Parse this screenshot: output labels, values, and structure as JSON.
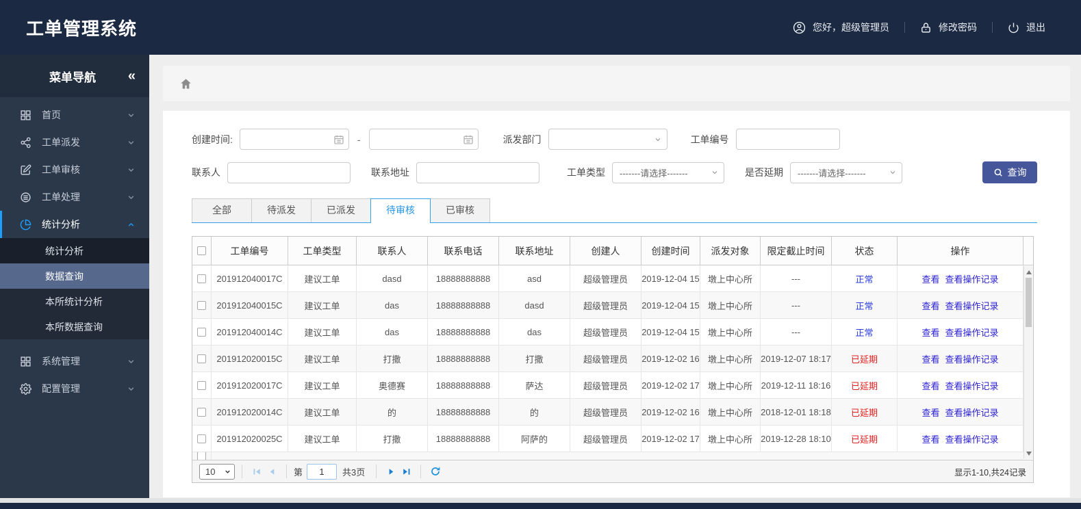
{
  "header": {
    "title": "工单管理系统",
    "greeting": "您好，超级管理员",
    "change_password": "修改密码",
    "logout": "退出"
  },
  "sidebar": {
    "title": "菜单导航",
    "collapse_icon": "«",
    "items": [
      {
        "key": "home",
        "label": "首页",
        "icon": "grid-icon"
      },
      {
        "key": "dispatch",
        "label": "工单派发",
        "icon": "share-icon"
      },
      {
        "key": "review",
        "label": "工单审核",
        "icon": "edit-icon"
      },
      {
        "key": "process",
        "label": "工单处理",
        "icon": "database-icon"
      },
      {
        "key": "stats",
        "label": "统计分析",
        "icon": "pie-chart-icon",
        "expanded": true,
        "children": [
          {
            "key": "stats-analysis",
            "label": "统计分析"
          },
          {
            "key": "data-query",
            "label": "数据查询",
            "selected": true
          },
          {
            "key": "branch-stats",
            "label": "本所统计分析"
          },
          {
            "key": "branch-data-query",
            "label": "本所数据查询"
          }
        ]
      },
      {
        "key": "system",
        "label": "系统管理",
        "icon": "apps-icon",
        "gap": true
      },
      {
        "key": "config",
        "label": "配置管理",
        "icon": "gear-icon"
      }
    ]
  },
  "filters": {
    "create_time_label": "创建时间:",
    "range_separator": "-",
    "dispatch_dept_label": "派发部门",
    "order_no_label": "工单编号",
    "contact_label": "联系人",
    "address_label": "联系地址",
    "order_type_label": "工单类型",
    "order_type_value": "-------请选择-------",
    "delay_label": "是否延期",
    "delay_value": "-------请选择-------",
    "search_button_label": "查询"
  },
  "tabs": [
    {
      "key": "all",
      "label": "全部"
    },
    {
      "key": "pending-dispatch",
      "label": "待派发"
    },
    {
      "key": "dispatched",
      "label": "已派发"
    },
    {
      "key": "pending-review",
      "label": "待审核",
      "active": true
    },
    {
      "key": "reviewed",
      "label": "已审核"
    }
  ],
  "table": {
    "columns": [
      "工单编号",
      "工单类型",
      "联系人",
      "联系电话",
      "联系地址",
      "创建人",
      "创建时间",
      "派发对象",
      "限定截止时间",
      "状态",
      "操作"
    ],
    "action_labels": [
      "查看",
      "查看操作记录"
    ],
    "status_colors": {
      "正常": "#2b3cd9",
      "已延期": "#e02020"
    },
    "rows": [
      {
        "order_no": "201912040017C",
        "order_type": "建议工单",
        "contact": "dasd",
        "phone": "18888888888",
        "address": "asd",
        "creator": "超级管理员",
        "created_at": "2019-12-04 15",
        "dispatch_target": "墩上中心所",
        "deadline": "---",
        "status": "正常"
      },
      {
        "order_no": "201912040015C",
        "order_type": "建议工单",
        "contact": "das",
        "phone": "18888888888",
        "address": "dasd",
        "creator": "超级管理员",
        "created_at": "2019-12-04 15",
        "dispatch_target": "墩上中心所",
        "deadline": "---",
        "status": "正常"
      },
      {
        "order_no": "201912040014C",
        "order_type": "建议工单",
        "contact": "das",
        "phone": "18888888888",
        "address": "das",
        "creator": "超级管理员",
        "created_at": "2019-12-04 15",
        "dispatch_target": "墩上中心所",
        "deadline": "---",
        "status": "正常"
      },
      {
        "order_no": "201912020015C",
        "order_type": "建议工单",
        "contact": "打撒",
        "phone": "18888888888",
        "address": "打撒",
        "creator": "超级管理员",
        "created_at": "2019-12-02 16",
        "dispatch_target": "墩上中心所",
        "deadline": "2019-12-07 18:17",
        "status": "已延期"
      },
      {
        "order_no": "201912020017C",
        "order_type": "建议工单",
        "contact": "奥德赛",
        "phone": "18888888888",
        "address": "萨达",
        "creator": "超级管理员",
        "created_at": "2019-12-02 17",
        "dispatch_target": "墩上中心所",
        "deadline": "2019-12-11 18:16",
        "status": "已延期"
      },
      {
        "order_no": "201912020014C",
        "order_type": "建议工单",
        "contact": "的",
        "phone": "18888888888",
        "address": "的",
        "creator": "超级管理员",
        "created_at": "2019-12-02 16",
        "dispatch_target": "墩上中心所",
        "deadline": "2018-12-01 18:18",
        "status": "已延期"
      },
      {
        "order_no": "201912020025C",
        "order_type": "建议工单",
        "contact": "打撒",
        "phone": "18888888888",
        "address": "阿萨的",
        "creator": "超级管理员",
        "created_at": "2019-12-02 17",
        "dispatch_target": "墩上中心所",
        "deadline": "2019-12-28 18:10",
        "status": "已延期"
      }
    ]
  },
  "pagination": {
    "page_size": "10",
    "page_label_prefix": "第",
    "current_page": "1",
    "total_pages_label": "共3页",
    "summary": "显示1-10,共24记录"
  },
  "colors": {
    "header_navy": "#1b2942",
    "sidebar_dark": "#2b3849",
    "accent_blue": "#1e9fff",
    "button_blue": "#45569b",
    "link_blue": "#2a1fd3",
    "status_normal": "#2b3cd9",
    "status_delayed": "#e02020"
  }
}
